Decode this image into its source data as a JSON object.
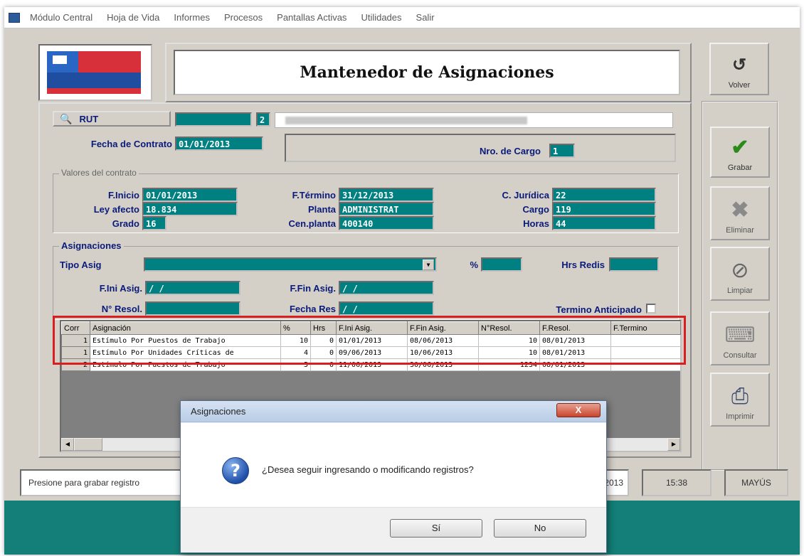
{
  "menu": {
    "items": [
      "Módulo Central",
      "Hoja de Vida",
      "Informes",
      "Procesos",
      "Pantallas Activas",
      "Utilidades",
      "Salir"
    ]
  },
  "header": {
    "title": "Mantenedor de Asignaciones"
  },
  "side_buttons": {
    "volver": "Volver",
    "grabar": "Grabar",
    "eliminar": "Eliminar",
    "limpiar": "Limpiar",
    "consultar": "Consultar",
    "imprimir": "Imprimir"
  },
  "top_form": {
    "rut_button": "RUT",
    "rut_dv": "2",
    "fecha_contrato_label": "Fecha de Contrato",
    "fecha_contrato": "01/01/2013",
    "nro_cargo_label": "Nro. de Cargo",
    "nro_cargo": "1"
  },
  "valores": {
    "legend": "Valores del contrato",
    "f_inicio_label": "F.Inicio",
    "f_inicio": "01/01/2013",
    "ley_afecto_label": "Ley afecto",
    "ley_afecto": "18.834",
    "grado_label": "Grado",
    "grado": "16",
    "f_termino_label": "F.Término",
    "f_termino": "31/12/2013",
    "planta_label": "Planta",
    "planta": "ADMINISTRAT",
    "cen_planta_label": "Cen.planta",
    "cen_planta": "400140",
    "c_juridica_label": "C. Jurídica",
    "c_juridica": "22",
    "cargo_label": "Cargo",
    "cargo": "119",
    "horas_label": "Horas",
    "horas": "44"
  },
  "asignaciones": {
    "legend": "Asignaciones",
    "tipo_asig_label": "Tipo Asig",
    "pct_label": "%",
    "hrs_redis_label": "Hrs Redis",
    "f_ini_label": "F.Ini  Asig.",
    "f_ini": "  /  /",
    "f_fin_label": "F.Fin Asig.",
    "f_fin": "  /  /",
    "nresol_label": "N° Resol.",
    "fecha_res_label": "Fecha Res",
    "fecha_res": "  /  /",
    "termino_anticipado_label": "Termino Anticipado"
  },
  "grid": {
    "columns": [
      "Corr",
      "Asignación",
      "%",
      "Hrs",
      "F.Ini Asig.",
      "F.Fin Asig.",
      "N°Resol.",
      "F.Resol.",
      "F.Termino"
    ],
    "rows": [
      [
        "1",
        "Estímulo Por Puestos de Trabajo",
        "10",
        "0",
        "01/01/2013",
        "08/06/2013",
        "10",
        "08/01/2013",
        ""
      ],
      [
        "1",
        "Estímulo Por Unidades Críticas de",
        "4",
        "0",
        "09/06/2013",
        "10/06/2013",
        "10",
        "08/01/2013",
        ""
      ],
      [
        "2",
        "Estímulo Por Puestos de Trabajo",
        "5",
        "0",
        "11/06/2013",
        "30/06/2013",
        "1234",
        "08/01/2013",
        ""
      ]
    ]
  },
  "status": {
    "message": "Presione para grabar registro",
    "box2": "11/06/2013",
    "time": "15:38",
    "caps": "MAYÚS"
  },
  "dialog": {
    "title": "Asignaciones",
    "close": "X",
    "message": "¿Desea seguir ingresando o modificando registros?",
    "yes": "Sí",
    "no": "No"
  }
}
